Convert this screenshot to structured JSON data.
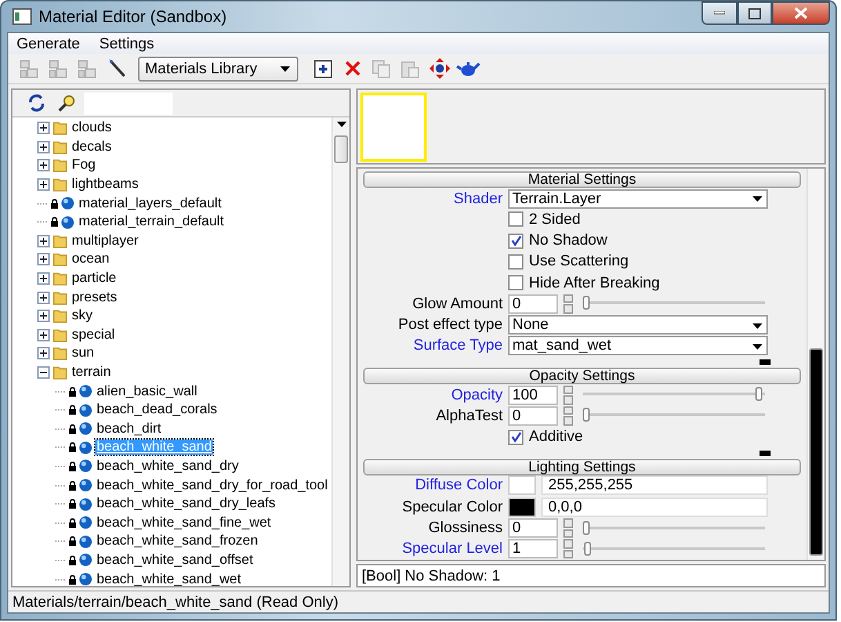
{
  "window": {
    "title": "Material Editor (Sandbox)"
  },
  "menu": [
    {
      "label": "Generate"
    },
    {
      "label": "Settings"
    }
  ],
  "toolbar": {
    "tools_left": [
      {
        "kind": "cubes",
        "disabled": true
      },
      {
        "kind": "cubes",
        "disabled": true
      },
      {
        "kind": "cubes",
        "disabled": true
      },
      {
        "kind": "wand",
        "disabled": false
      }
    ],
    "library_select": {
      "value": "Materials Library"
    },
    "tools_right": [
      {
        "kind": "add",
        "disabled": false
      },
      {
        "kind": "delete",
        "disabled": false
      },
      {
        "kind": "copy",
        "disabled": true
      },
      {
        "kind": "paste",
        "disabled": true
      },
      {
        "kind": "move",
        "disabled": false
      },
      {
        "kind": "teapot",
        "disabled": false
      }
    ]
  },
  "tree": {
    "items": [
      {
        "label": "clouds",
        "kind": "folder",
        "expanded": false,
        "selected": false
      },
      {
        "label": "decals",
        "kind": "folder",
        "expanded": false,
        "selected": false
      },
      {
        "label": "Fog",
        "kind": "folder",
        "expanded": false,
        "selected": false
      },
      {
        "label": "lightbeams",
        "kind": "folder",
        "expanded": false,
        "selected": false
      },
      {
        "label": "material_layers_default",
        "kind": "material",
        "locked": true,
        "selected": false
      },
      {
        "label": "material_terrain_default",
        "kind": "material",
        "locked": true,
        "selected": false
      },
      {
        "label": "multiplayer",
        "kind": "folder",
        "expanded": false,
        "selected": false
      },
      {
        "label": "ocean",
        "kind": "folder",
        "expanded": false,
        "selected": false
      },
      {
        "label": "particle",
        "kind": "folder",
        "expanded": false,
        "selected": false
      },
      {
        "label": "presets",
        "kind": "folder",
        "expanded": false,
        "selected": false
      },
      {
        "label": "sky",
        "kind": "folder",
        "expanded": false,
        "selected": false
      },
      {
        "label": "special",
        "kind": "folder",
        "expanded": false,
        "selected": false
      },
      {
        "label": "sun",
        "kind": "folder",
        "expanded": false,
        "selected": false
      },
      {
        "label": "terrain",
        "kind": "folder",
        "expanded": true,
        "selected": false,
        "children": [
          {
            "label": "alien_basic_wall",
            "kind": "material",
            "locked": true,
            "selected": false
          },
          {
            "label": "beach_dead_corals",
            "kind": "material",
            "locked": true,
            "selected": false
          },
          {
            "label": "beach_dirt",
            "kind": "material",
            "locked": true,
            "selected": false
          },
          {
            "label": "beach_white_sand",
            "kind": "material",
            "locked": true,
            "selected": true
          },
          {
            "label": "beach_white_sand_dry",
            "kind": "material",
            "locked": true,
            "selected": false
          },
          {
            "label": "beach_white_sand_dry_for_road_tool",
            "kind": "material",
            "locked": true,
            "selected": false
          },
          {
            "label": "beach_white_sand_dry_leafs",
            "kind": "material",
            "locked": true,
            "selected": false
          },
          {
            "label": "beach_white_sand_fine_wet",
            "kind": "material",
            "locked": true,
            "selected": false
          },
          {
            "label": "beach_white_sand_frozen",
            "kind": "material",
            "locked": true,
            "selected": false
          },
          {
            "label": "beach_white_sand_offset",
            "kind": "material",
            "locked": true,
            "selected": false
          },
          {
            "label": "beach_white_sand_wet",
            "kind": "material",
            "locked": true,
            "selected": false
          }
        ]
      }
    ]
  },
  "properties": {
    "sections": [
      {
        "title": "Material Settings",
        "rows": [
          {
            "kind": "select",
            "label": "Shader",
            "changed": true,
            "value": "Terrain.Layer"
          },
          {
            "kind": "checkbox",
            "label": "2 Sided",
            "checked": false
          },
          {
            "kind": "checkbox",
            "label": "No Shadow",
            "checked": true
          },
          {
            "kind": "checkbox",
            "label": "Use Scattering",
            "checked": false
          },
          {
            "kind": "checkbox",
            "label": "Hide After Breaking",
            "checked": false
          },
          {
            "kind": "number",
            "label": "Glow Amount",
            "changed": false,
            "value": "0",
            "level": 0
          },
          {
            "kind": "select",
            "label": "Post effect type",
            "changed": false,
            "value": "None"
          },
          {
            "kind": "select",
            "label": "Surface Type",
            "changed": true,
            "value": "mat_sand_wet"
          }
        ]
      },
      {
        "title": "Opacity Settings",
        "rows": [
          {
            "kind": "number",
            "label": "Opacity",
            "changed": true,
            "value": "100",
            "level": 1
          },
          {
            "kind": "number",
            "label": "AlphaTest",
            "changed": false,
            "value": "0",
            "level": 0
          },
          {
            "kind": "checkbox",
            "label": "Additive",
            "checked": true
          }
        ]
      },
      {
        "title": "Lighting Settings",
        "rows": [
          {
            "kind": "color",
            "label": "Diffuse Color",
            "changed": true,
            "color": "#ffffff",
            "value": "255,255,255"
          },
          {
            "kind": "color",
            "label": "Specular Color",
            "changed": false,
            "color": "#000000",
            "value": "0,0,0"
          },
          {
            "kind": "number",
            "label": "Glossiness",
            "changed": false,
            "value": "0",
            "level": 0
          },
          {
            "kind": "number",
            "label": "Specular Level",
            "changed": true,
            "value": "1",
            "level": 0.01
          }
        ]
      }
    ]
  },
  "description": "[Bool] No Shadow: 1",
  "status_bar": "Materials/terrain/beach_white_sand (Read Only)"
}
